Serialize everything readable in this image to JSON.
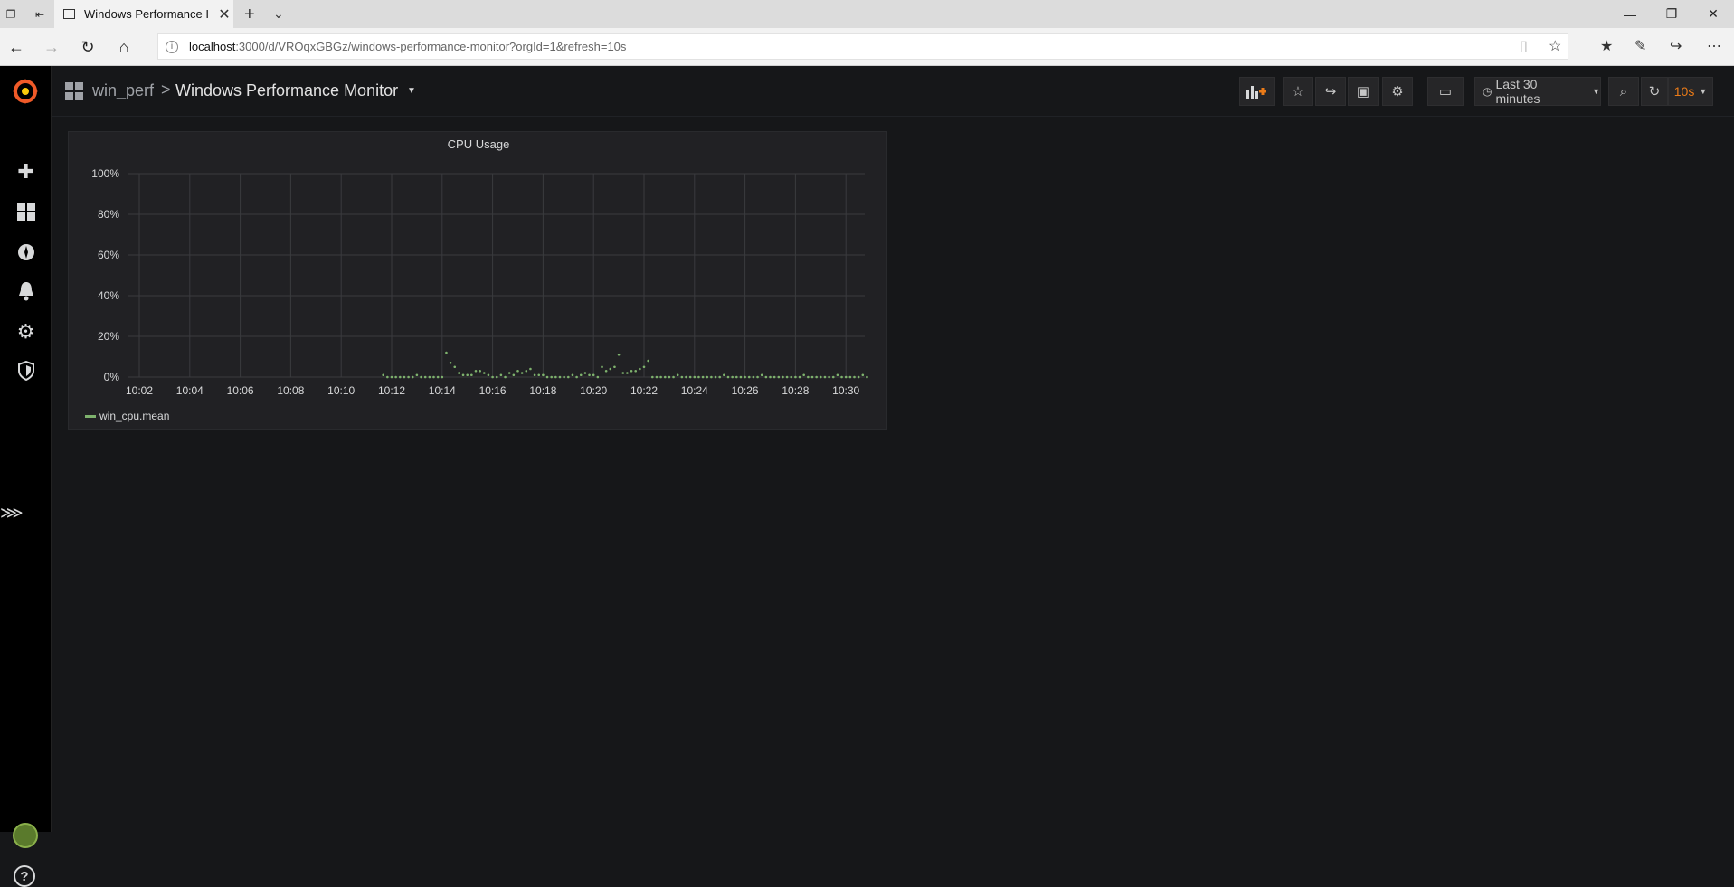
{
  "browser": {
    "tab_title": "Windows Performance I",
    "url_host": "localhost",
    "url_path": ":3000/d/VROqxGBGz/windows-performance-monitor?orgId=1&refresh=10s"
  },
  "navbar": {
    "folder": "win_perf",
    "separator": ">",
    "title": "Windows Performance Monitor",
    "time_range": "Last 30 minutes",
    "refresh_interval": "10s"
  },
  "panel": {
    "title": "CPU Usage",
    "legend": "win_cpu.mean"
  },
  "colors": {
    "series": "#7eb26d",
    "accent": "#eb7b18",
    "background": "#161719",
    "panel": "#212124"
  },
  "chart_data": {
    "type": "scatter",
    "title": "CPU Usage",
    "xlabel": "",
    "ylabel": "",
    "ylim": [
      0,
      100
    ],
    "y_ticks": [
      "100%",
      "80%",
      "60%",
      "40%",
      "20%",
      "0%"
    ],
    "x_ticks": [
      "10:02",
      "10:04",
      "10:06",
      "10:08",
      "10:10",
      "10:12",
      "10:14",
      "10:16",
      "10:18",
      "10:20",
      "10:22",
      "10:24",
      "10:26",
      "10:28",
      "10:30"
    ],
    "grid": true,
    "legend_position": "bottom-left",
    "series": [
      {
        "name": "win_cpu.mean",
        "x": [
          "10:11:40",
          "10:11:50",
          "10:12:00",
          "10:12:10",
          "10:12:20",
          "10:12:30",
          "10:12:40",
          "10:12:50",
          "10:13:00",
          "10:13:10",
          "10:13:20",
          "10:13:30",
          "10:13:40",
          "10:13:50",
          "10:14:00",
          "10:14:10",
          "10:14:20",
          "10:14:30",
          "10:14:40",
          "10:14:50",
          "10:15:00",
          "10:15:10",
          "10:15:20",
          "10:15:30",
          "10:15:40",
          "10:15:50",
          "10:16:00",
          "10:16:10",
          "10:16:20",
          "10:16:30",
          "10:16:40",
          "10:16:50",
          "10:17:00",
          "10:17:10",
          "10:17:20",
          "10:17:30",
          "10:17:40",
          "10:17:50",
          "10:18:00",
          "10:18:10",
          "10:18:20",
          "10:18:30",
          "10:18:40",
          "10:18:50",
          "10:19:00",
          "10:19:10",
          "10:19:20",
          "10:19:30",
          "10:19:40",
          "10:19:50",
          "10:20:00",
          "10:20:10",
          "10:20:20",
          "10:20:30",
          "10:20:40",
          "10:20:50",
          "10:21:00",
          "10:21:10",
          "10:21:20",
          "10:21:30",
          "10:21:40",
          "10:21:50",
          "10:22:00",
          "10:22:10",
          "10:22:20",
          "10:22:30",
          "10:22:40",
          "10:22:50",
          "10:23:00",
          "10:23:10",
          "10:23:20",
          "10:23:30",
          "10:23:40",
          "10:23:50",
          "10:24:00",
          "10:24:10",
          "10:24:20",
          "10:24:30",
          "10:24:40",
          "10:24:50",
          "10:25:00",
          "10:25:10",
          "10:25:20",
          "10:25:30",
          "10:25:40",
          "10:25:50",
          "10:26:00",
          "10:26:10",
          "10:26:20",
          "10:26:30",
          "10:26:40",
          "10:26:50",
          "10:27:00",
          "10:27:10",
          "10:27:20",
          "10:27:30",
          "10:27:40",
          "10:27:50",
          "10:28:00",
          "10:28:10",
          "10:28:20",
          "10:28:30",
          "10:28:40",
          "10:28:50",
          "10:29:00",
          "10:29:10",
          "10:29:20",
          "10:29:30",
          "10:29:40",
          "10:29:50",
          "10:30:00",
          "10:30:10",
          "10:30:20",
          "10:30:30",
          "10:30:40",
          "10:30:50"
        ],
        "values": [
          1,
          0,
          0,
          0,
          0,
          0,
          0,
          0,
          1,
          0,
          0,
          0,
          0,
          0,
          0,
          12,
          7,
          5,
          2,
          1,
          1,
          1,
          3,
          3,
          2,
          1,
          0,
          0,
          1,
          0,
          2,
          1,
          3,
          2,
          3,
          4,
          1,
          1,
          1,
          0,
          0,
          0,
          0,
          0,
          0,
          1,
          0,
          1,
          2,
          1,
          1,
          0,
          5,
          3,
          4,
          5,
          11,
          2,
          2,
          3,
          3,
          4,
          5,
          8,
          0,
          0,
          0,
          0,
          0,
          0,
          1,
          0,
          0,
          0,
          0,
          0,
          0,
          0,
          0,
          0,
          0,
          1,
          0,
          0,
          0,
          0,
          0,
          0,
          0,
          0,
          1,
          0,
          0,
          0,
          0,
          0,
          0,
          0,
          0,
          0,
          1,
          0,
          0,
          0,
          0,
          0,
          0,
          0,
          1,
          0,
          0,
          0,
          0,
          0,
          1,
          0
        ]
      }
    ]
  }
}
